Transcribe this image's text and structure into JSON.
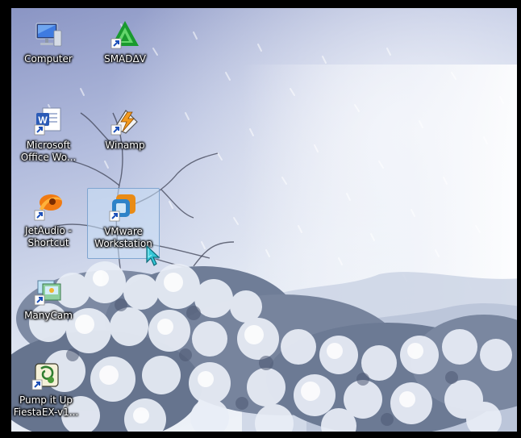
{
  "desktop": {
    "icons": [
      {
        "label": "Computer",
        "icon": "computer-icon"
      },
      {
        "label": "SMADΔV",
        "icon": "smadav-shortcut-icon"
      },
      {
        "label": "Microsoft\nOffice Wo...",
        "icon": "word-shortcut-icon"
      },
      {
        "label": "Winamp",
        "icon": "winamp-shortcut-icon"
      },
      {
        "label": "JetAudio -\nShortcut",
        "icon": "jetaudio-shortcut-icon"
      },
      {
        "label": "VMware\nWorkstation",
        "icon": "vmware-shortcut-icon",
        "selected": true
      },
      {
        "label": "ManyCam",
        "icon": "manycam-shortcut-icon"
      },
      {
        "label": "Pump it Up\nFiestaEX-v1...",
        "icon": "pump-it-up-shortcut-icon"
      }
    ]
  },
  "colors": {
    "sky_top": "#8e99c6",
    "sky_bottom": "#e6ecf6",
    "snow_tree": "#dfe6f2",
    "selection": "#c8def5"
  }
}
